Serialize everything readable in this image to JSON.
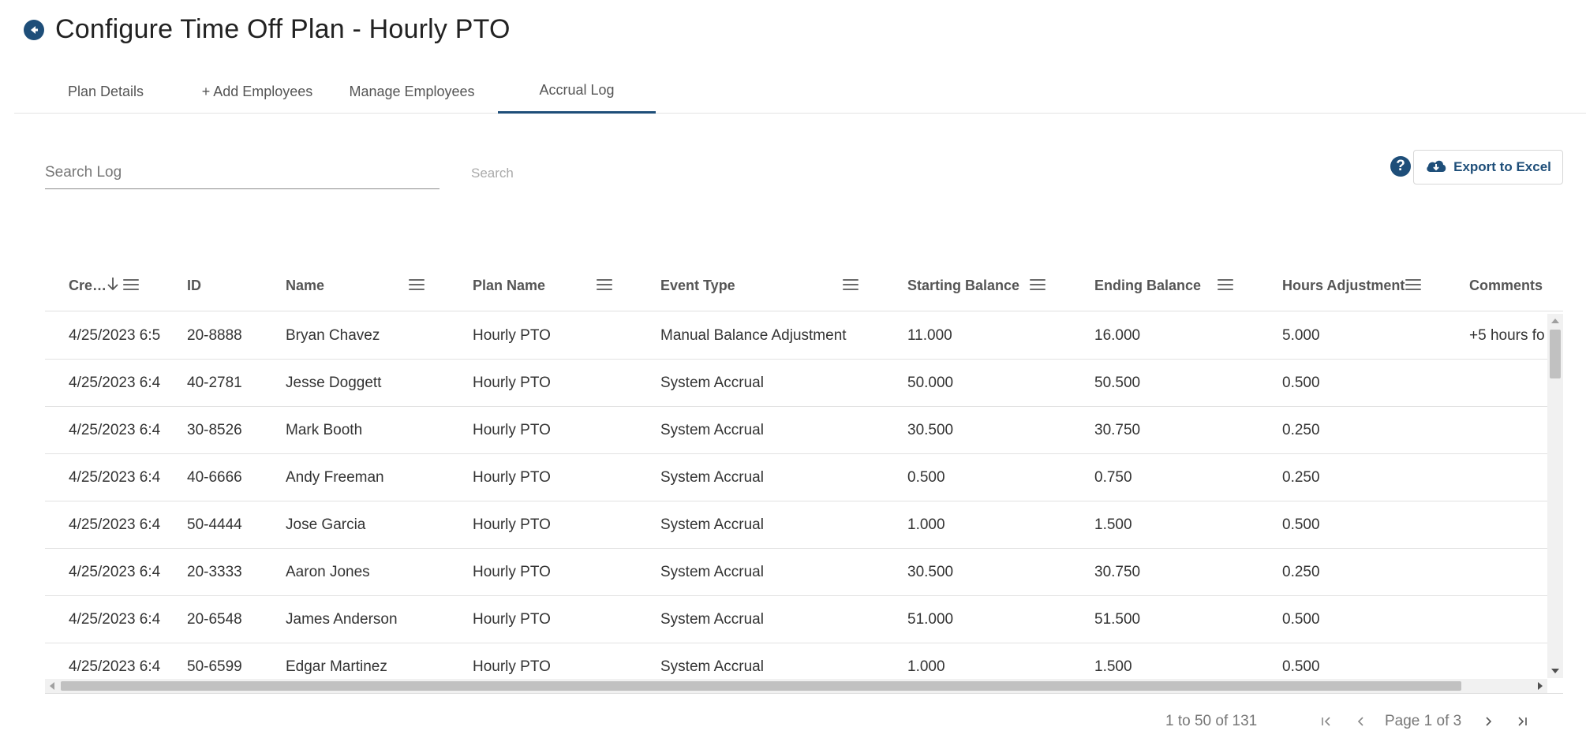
{
  "header": {
    "title": "Configure Time Off Plan - Hourly PTO"
  },
  "tabs": [
    {
      "label": "Plan Details"
    },
    {
      "label": "+ Add Employees"
    },
    {
      "label": "Manage Employees"
    },
    {
      "label": "Accrual Log",
      "active": true
    }
  ],
  "search": {
    "placeholder": "Search Log",
    "value": "",
    "button_label": "Search"
  },
  "toolbar": {
    "help_label": "?",
    "export_label": "Export to Excel"
  },
  "grid": {
    "columns": [
      {
        "label": "Cre…"
      },
      {
        "label": "ID"
      },
      {
        "label": "Name"
      },
      {
        "label": "Plan Name"
      },
      {
        "label": "Event Type"
      },
      {
        "label": "Starting Balance"
      },
      {
        "label": "Ending Balance"
      },
      {
        "label": "Hours Adjustment"
      },
      {
        "label": "Comments"
      }
    ],
    "rows": [
      {
        "created": "4/25/2023 6:5",
        "id": "20-8888",
        "name": "Bryan Chavez",
        "plan": "Hourly PTO",
        "event": "Manual Balance Adjustment",
        "start": "11.000",
        "end": "16.000",
        "adj": "5.000",
        "comments": "+5 hours fo"
      },
      {
        "created": "4/25/2023 6:4",
        "id": "40-2781",
        "name": "Jesse Doggett",
        "plan": "Hourly PTO",
        "event": "System Accrual",
        "start": "50.000",
        "end": "50.500",
        "adj": "0.500",
        "comments": ""
      },
      {
        "created": "4/25/2023 6:4",
        "id": "30-8526",
        "name": "Mark Booth",
        "plan": "Hourly PTO",
        "event": "System Accrual",
        "start": "30.500",
        "end": "30.750",
        "adj": "0.250",
        "comments": ""
      },
      {
        "created": "4/25/2023 6:4",
        "id": "40-6666",
        "name": "Andy Freeman",
        "plan": "Hourly PTO",
        "event": "System Accrual",
        "start": "0.500",
        "end": "0.750",
        "adj": "0.250",
        "comments": ""
      },
      {
        "created": "4/25/2023 6:4",
        "id": "50-4444",
        "name": "Jose Garcia",
        "plan": "Hourly PTO",
        "event": "System Accrual",
        "start": "1.000",
        "end": "1.500",
        "adj": "0.500",
        "comments": ""
      },
      {
        "created": "4/25/2023 6:4",
        "id": "20-3333",
        "name": "Aaron Jones",
        "plan": "Hourly PTO",
        "event": "System Accrual",
        "start": "30.500",
        "end": "30.750",
        "adj": "0.250",
        "comments": ""
      },
      {
        "created": "4/25/2023 6:4",
        "id": "20-6548",
        "name": "James Anderson",
        "plan": "Hourly PTO",
        "event": "System Accrual",
        "start": "51.000",
        "end": "51.500",
        "adj": "0.500",
        "comments": ""
      },
      {
        "created": "4/25/2023 6:4",
        "id": "50-6599",
        "name": "Edgar Martinez",
        "plan": "Hourly PTO",
        "event": "System Accrual",
        "start": "1.000",
        "end": "1.500",
        "adj": "0.500",
        "comments": ""
      }
    ]
  },
  "pagination": {
    "summary": "1 to 50 of 131",
    "page_label": "Page 1 of 3"
  },
  "colors": {
    "accent": "#1e4e79"
  }
}
